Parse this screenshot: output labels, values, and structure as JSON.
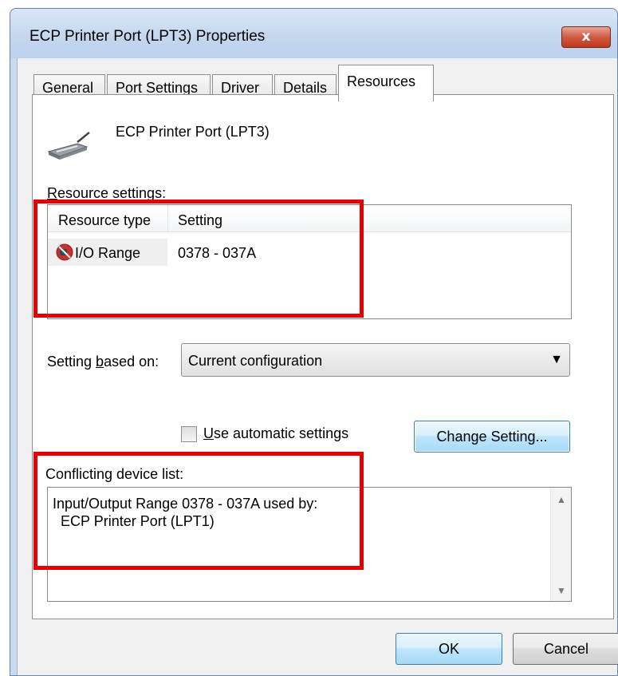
{
  "window": {
    "title": "ECP Printer Port (LPT3) Properties",
    "close_label": "x"
  },
  "tabs": [
    {
      "label": "General"
    },
    {
      "label": "Port Settings"
    },
    {
      "label": "Driver"
    },
    {
      "label": "Details"
    },
    {
      "label": "Resources",
      "active": true
    }
  ],
  "device": {
    "name": "ECP Printer Port (LPT3)",
    "icon": "printer-port-icon"
  },
  "resource_settings": {
    "label_prefix": "R",
    "label_rest": "esource settings:",
    "columns": [
      "Resource type",
      "Setting"
    ],
    "rows": [
      {
        "type": "I/O Range",
        "setting": "0378 - 037A",
        "icon": "conflict-icon"
      }
    ]
  },
  "setting_based_on": {
    "label_pre": "Setting ",
    "label_u": "b",
    "label_post": "ased on:",
    "value": "Current configuration"
  },
  "auto_settings": {
    "label_u": "U",
    "label_rest": "se automatic settings",
    "checked": false
  },
  "change_setting_label": "Change Setting...",
  "conflicting": {
    "label": "Conflicting device list:",
    "line1": "Input/Output Range 0378 - 037A used by:",
    "line2": "  ECP Printer Port (LPT1)"
  },
  "footer": {
    "ok_label": "OK",
    "cancel_label": "Cancel"
  },
  "colors": {
    "highlight": "#e30000",
    "title_bar": "#c3d6ee",
    "close_button": "#c1391d"
  }
}
